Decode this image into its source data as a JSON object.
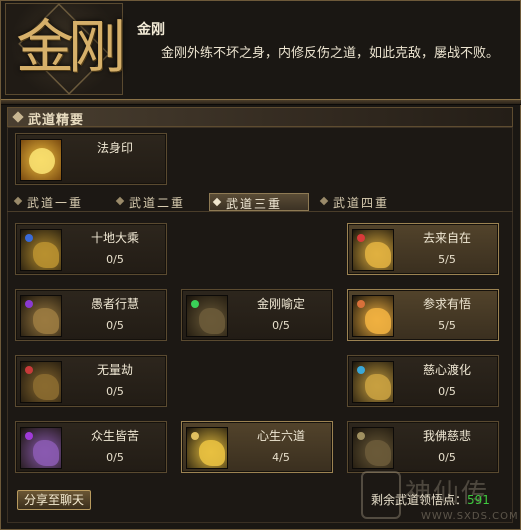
{
  "header": {
    "emblem_glyph": "金刚",
    "title": "金刚",
    "description": "金刚外练不坏之身，内修反伤之道，如此克敌，屡战不败。"
  },
  "section": {
    "title": "武道精要"
  },
  "top_skill": {
    "name": "法身印",
    "icon": "golden-seal-icon",
    "color": "#e0b030"
  },
  "tabs": [
    {
      "label": "武道一重",
      "active": false
    },
    {
      "label": "武道二重",
      "active": false
    },
    {
      "label": "武道三重",
      "active": true
    },
    {
      "label": "武道四重",
      "active": false
    }
  ],
  "skills": [
    {
      "name": "十地大乘",
      "level": "0/5",
      "icon": "blue-gold-swirl-icon",
      "dot": "#3a6ad8",
      "color": "#b89030"
    },
    {
      "name": "去来自在",
      "level": "5/5",
      "icon": "red-gold-flame-icon",
      "dot": "#d83a3a",
      "color": "#e0b040"
    },
    {
      "name": "愚者行慧",
      "level": "0/5",
      "icon": "purple-scroll-icon",
      "dot": "#8a3ad0",
      "color": "#9a7a40"
    },
    {
      "name": "金刚喻定",
      "level": "0/5",
      "icon": "green-armor-icon",
      "dot": "#3ad058",
      "color": "#6a5a38"
    },
    {
      "name": "参求有悟",
      "level": "5/5",
      "icon": "orange-light-icon",
      "dot": "#d8703a",
      "color": "#f0b040"
    },
    {
      "name": "无量劫",
      "level": "0/5",
      "icon": "red-brown-relic-icon",
      "dot": "#c83a3a",
      "color": "#8a6a30"
    },
    {
      "name": "慈心渡化",
      "level": "0/5",
      "icon": "blue-shrine-icon",
      "dot": "#3aa8d8",
      "color": "#c8a040"
    },
    {
      "name": "众生皆苦",
      "level": "0/5",
      "icon": "purple-figure-icon",
      "dot": "#a03ad8",
      "color": "#8a5ab0"
    },
    {
      "name": "心生六道",
      "level": "4/5",
      "icon": "golden-trident-icon",
      "dot": "#e0c060",
      "color": "#e8c040"
    },
    {
      "name": "我佛慈悲",
      "level": "0/5",
      "icon": "dark-gold-relic-icon",
      "dot": "#a09060",
      "color": "#6a5a38"
    }
  ],
  "footer": {
    "share_label": "分享至聊天",
    "points_label": "剩余武道领悟点：",
    "points_value": "591",
    "watermark_text": "神仙传",
    "watermark_url": "WWW.SXDS.COM"
  }
}
